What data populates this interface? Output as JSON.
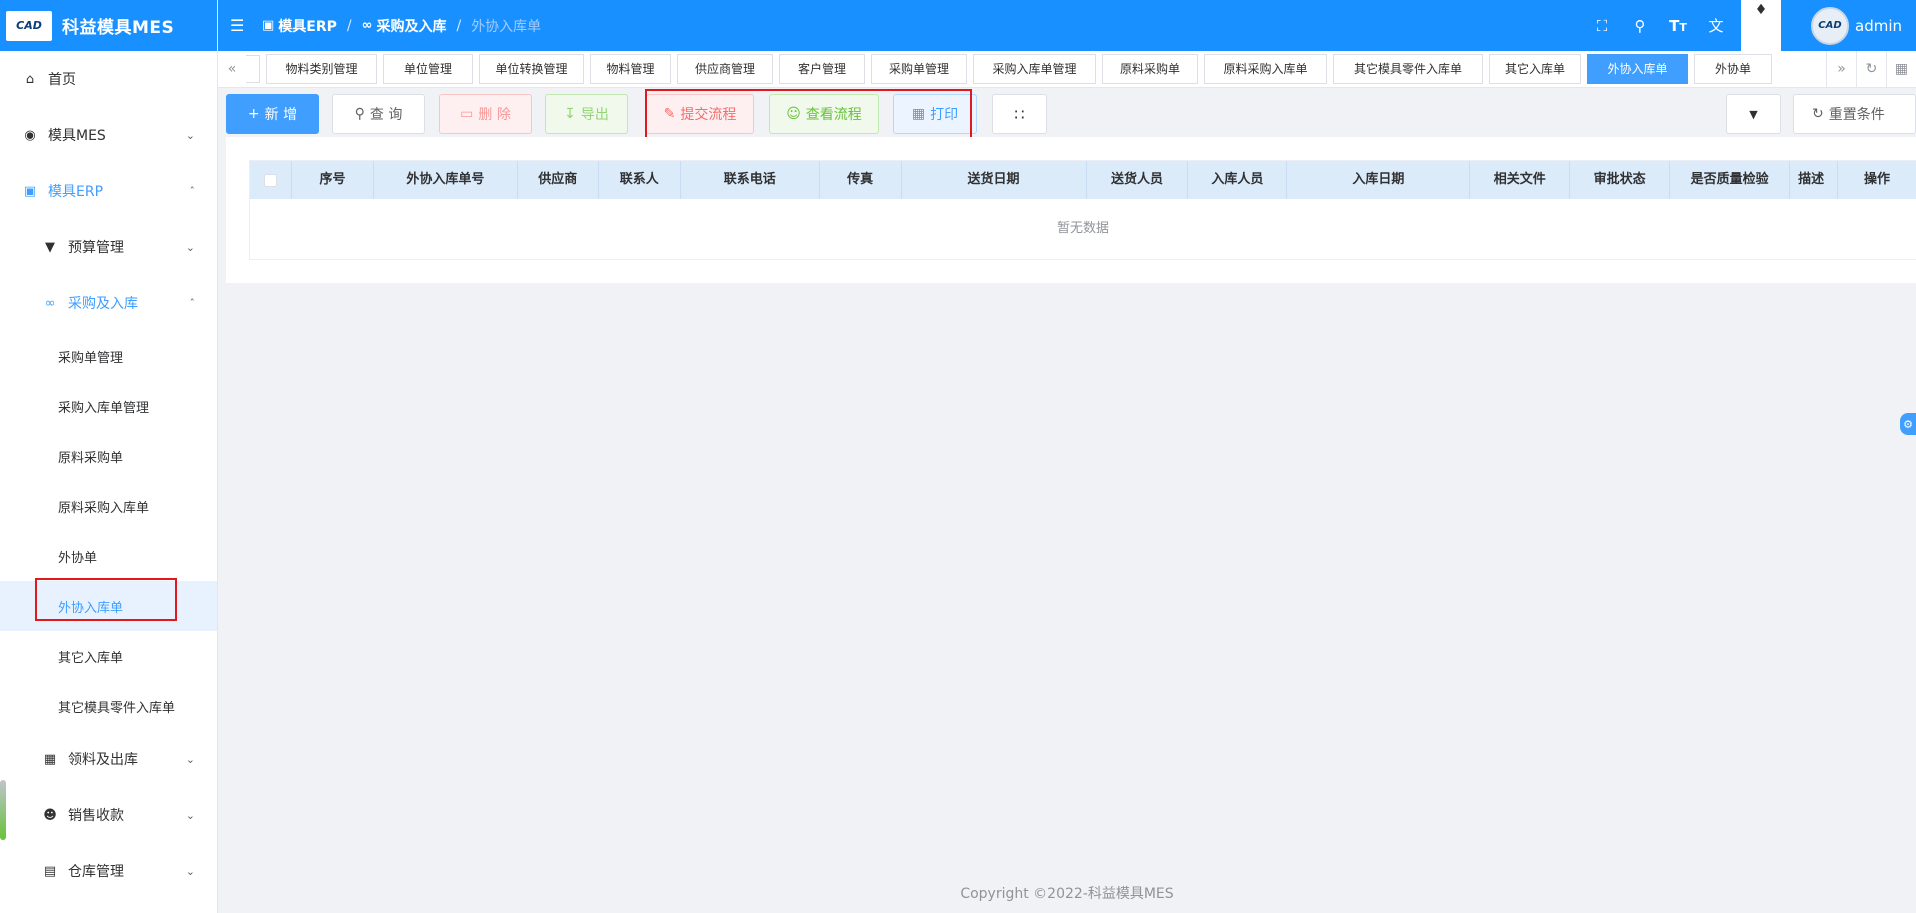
{
  "app": {
    "logo_text": "CAD",
    "title": "科益模具MES"
  },
  "sidebar": {
    "items": [
      {
        "label": "首页",
        "icon": "home-icon"
      },
      {
        "label": "模具MES",
        "icon": "camera-icon"
      },
      {
        "label": "模具ERP",
        "icon": "bag-icon"
      },
      {
        "label": "预算管理",
        "icon": "funnel-icon"
      },
      {
        "label": "采购及入库",
        "icon": "bicycle-icon"
      },
      {
        "label": "领料及出库",
        "icon": "building-icon"
      },
      {
        "label": "销售收款",
        "icon": "user-icon"
      },
      {
        "label": "仓库管理",
        "icon": "calendar-icon"
      }
    ],
    "sub_items": [
      "采购单管理",
      "采购入库单管理",
      "原料采购单",
      "原料采购入库单",
      "外协单",
      "外协入库单",
      "其它入库单",
      "其它模具零件入库单"
    ]
  },
  "header": {
    "breadcrumb": [
      "模具ERP",
      "采购及入库",
      "外协入库单"
    ],
    "user": "admin",
    "avatar_text": "CAD"
  },
  "tabs": [
    "物料类别管理",
    "单位管理",
    "单位转换管理",
    "物料管理",
    "供应商管理",
    "客户管理",
    "采购单管理",
    "采购入库单管理",
    "原料采购单",
    "原料采购入库单",
    "其它模具零件入库单",
    "其它入库单",
    "外协入库单",
    "外协单"
  ],
  "toolbar": {
    "add": "新 增",
    "query": "查 询",
    "delete": "删 除",
    "export": "导出",
    "submit_flow": "提交流程",
    "view_flow": "查看流程",
    "print": "打印",
    "reset": "重置条件"
  },
  "table": {
    "columns": [
      "序号",
      "外协入库单号",
      "供应商",
      "联系人",
      "联系电话",
      "传真",
      "送货日期",
      "送货人员",
      "入库人员",
      "入库日期",
      "相关文件",
      "审批状态",
      "是否质量检验",
      "描述",
      "操作"
    ],
    "empty_text": "暂无数据"
  },
  "footer": "Copyright ©2022-科益模具MES",
  "colors": {
    "primary": "#1890ff",
    "accent": "#409eff",
    "highlight": "#e0191f"
  }
}
